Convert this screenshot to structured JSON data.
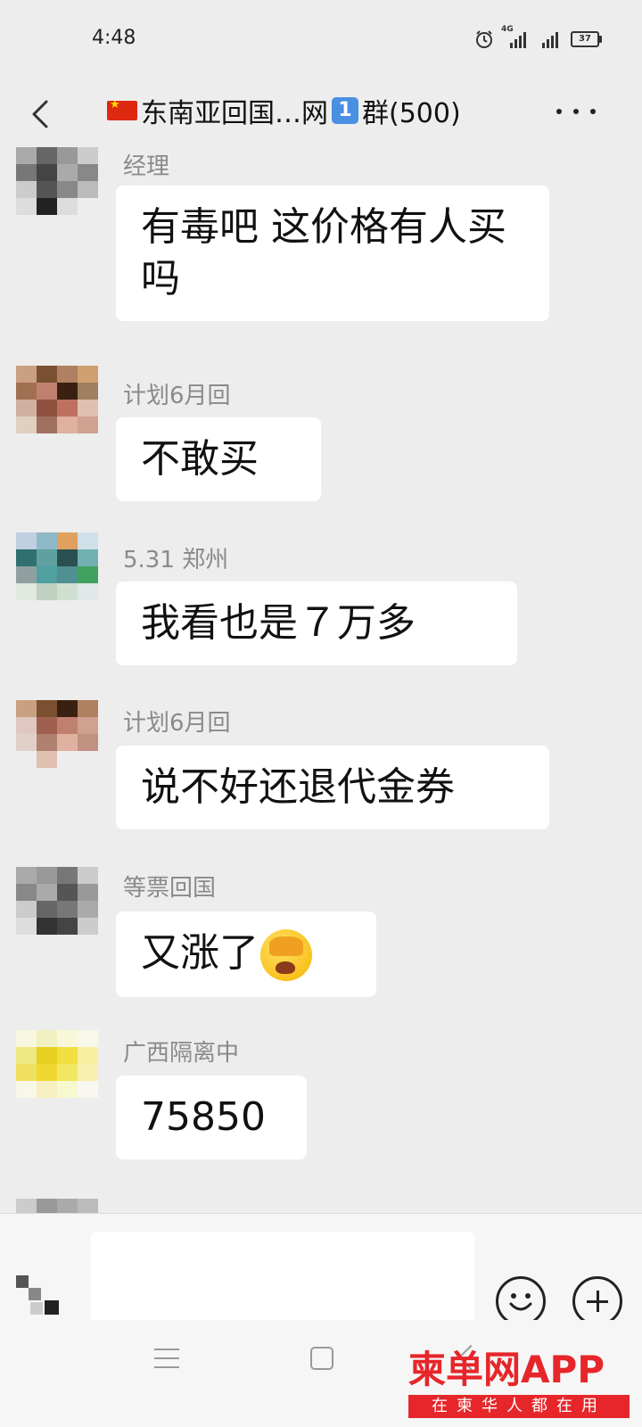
{
  "status": {
    "time": "4:48",
    "network": "4G",
    "battery": "37"
  },
  "header": {
    "title_pre": "东南亚回国…网",
    "title_key": "1",
    "title_post": "群(500)"
  },
  "messages": [
    {
      "sender": "经理",
      "text": "有毒吧  这价格有人买吗"
    },
    {
      "sender": "计划6月回",
      "text": "不敢买"
    },
    {
      "sender": "5.31  郑州",
      "text": "我看也是７万多"
    },
    {
      "sender": "计划6月回",
      "text": "说不好还退代金券"
    },
    {
      "sender": "等票回国",
      "text": "又涨了"
    },
    {
      "sender": "广西隔离中",
      "text": "75850"
    }
  ],
  "watermark": {
    "logo": "柬单网APP",
    "tagline": "在柬华人都在用"
  },
  "colors": {
    "background": "#ededed",
    "bubble": "#ffffff",
    "sender": "#8a8a8a",
    "watermark_red": "#e6262a"
  }
}
